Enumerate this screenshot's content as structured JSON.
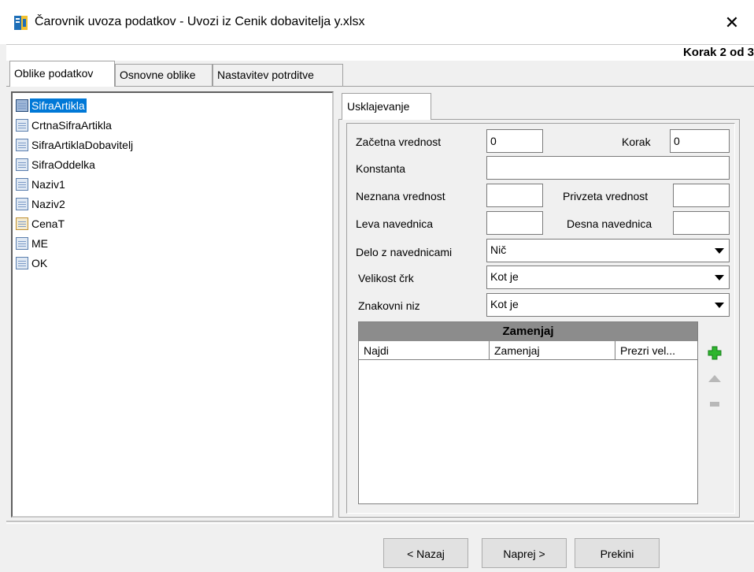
{
  "window": {
    "title": "Čarovnik uvoza podatkov - Uvozi iz Cenik dobavitelja y.xlsx",
    "close_glyph": "✕",
    "step": "Korak 2 od 3"
  },
  "tabs": [
    {
      "label": "Oblike podatkov",
      "active": true
    },
    {
      "label": "Osnovne oblike",
      "active": false
    },
    {
      "label": "Nastavitev potrditve",
      "active": false
    }
  ],
  "fields_list": [
    {
      "label": "SifraArtikla",
      "selected": true,
      "icon": "table-field-icon"
    },
    {
      "label": "CrtnaSifraArtikla",
      "icon": "table-field-icon"
    },
    {
      "label": "SifraArtiklaDobavitelj",
      "icon": "table-field-icon"
    },
    {
      "label": "SifraOddelka",
      "icon": "table-field-icon"
    },
    {
      "label": "Naziv1",
      "icon": "table-field-icon"
    },
    {
      "label": "Naziv2",
      "icon": "table-field-icon"
    },
    {
      "label": "CenaT",
      "icon": "key-field-icon"
    },
    {
      "label": "ME",
      "icon": "table-field-icon"
    },
    {
      "label": "OK",
      "icon": "table-field-icon"
    }
  ],
  "subtab": {
    "label": "Usklajevanje"
  },
  "form": {
    "zacetna_label": "Začetna vrednost",
    "zacetna_value": "0",
    "korak_label": "Korak",
    "korak_value": "0",
    "konstanta_label": "Konstanta",
    "konstanta_value": "",
    "neznana_label": "Neznana vrednost",
    "neznana_value": "",
    "privzeta_label": "Privzeta vrednost",
    "privzeta_value": "",
    "leva_label": "Leva navednica",
    "leva_value": "",
    "desna_label": "Desna navednica",
    "desna_value": "",
    "delo_label": "Delo z navednicami",
    "delo_value": "Nič",
    "velikost_label": "Velikost črk",
    "velikost_value": "Kot je",
    "znakovni_label": "Znakovni niz",
    "znakovni_value": "Kot je"
  },
  "replace_grid": {
    "title": "Zamenjaj",
    "columns": [
      "Najdi",
      "Zamenjaj",
      "Prezri vel..."
    ]
  },
  "buttons": {
    "back": "< Nazaj",
    "next": "Naprej >",
    "cancel": "Prekini"
  },
  "colors": {
    "selection": "#0078d7",
    "add_icon": "#2db52d",
    "disabled_icon": "#b8b8b8"
  }
}
